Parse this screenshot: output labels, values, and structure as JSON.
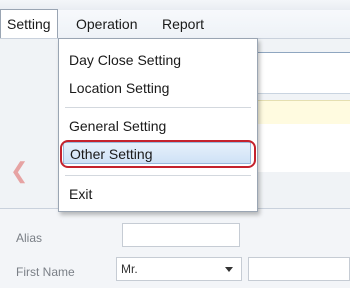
{
  "menubar": {
    "items": [
      {
        "label": "Setting"
      },
      {
        "label": "Operation"
      },
      {
        "label": "Report"
      }
    ]
  },
  "dropdown": {
    "items": [
      {
        "label": "Day Close Setting"
      },
      {
        "label": "Location Setting"
      },
      {
        "label": "General Setting"
      },
      {
        "label": "Other Setting"
      },
      {
        "label": "Exit"
      }
    ],
    "highlighted": "Other Setting"
  },
  "form": {
    "alias_label": "Alias",
    "alias_value": "",
    "first_name_label": "First Name",
    "title_select_value": "Mr.",
    "first_name_value": ""
  },
  "colors": {
    "highlight_ring": "#c4222d",
    "hover_bg": "#cfe2f6"
  }
}
